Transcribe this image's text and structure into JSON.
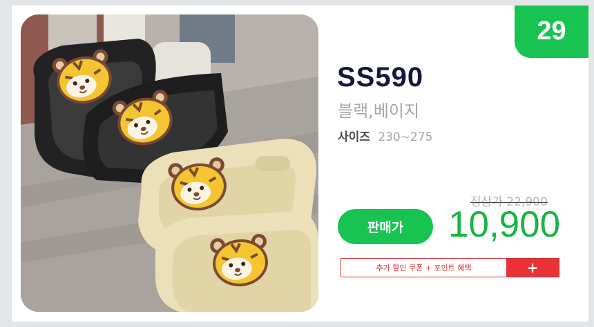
{
  "product": {
    "rank": "29",
    "model": "SS590",
    "colors": "블랙,베이지",
    "size_label": "사이즈",
    "size_value": "230~275",
    "original_price": "정상가 22,900",
    "sale_label": "판매가",
    "sale_price": "10,900",
    "coupon_text": "추가 할인 쿠폰 + 포인트 혜택",
    "coupon_plus": "+"
  },
  "image": {
    "subject": "tiger-character slide sandals, black and beige pairs",
    "icon": "tiger-face-icon"
  },
  "colors": {
    "accent_green": "#19c351",
    "price_green": "#19b441",
    "coupon_red": "#e93237",
    "model_navy": "#16173d"
  }
}
